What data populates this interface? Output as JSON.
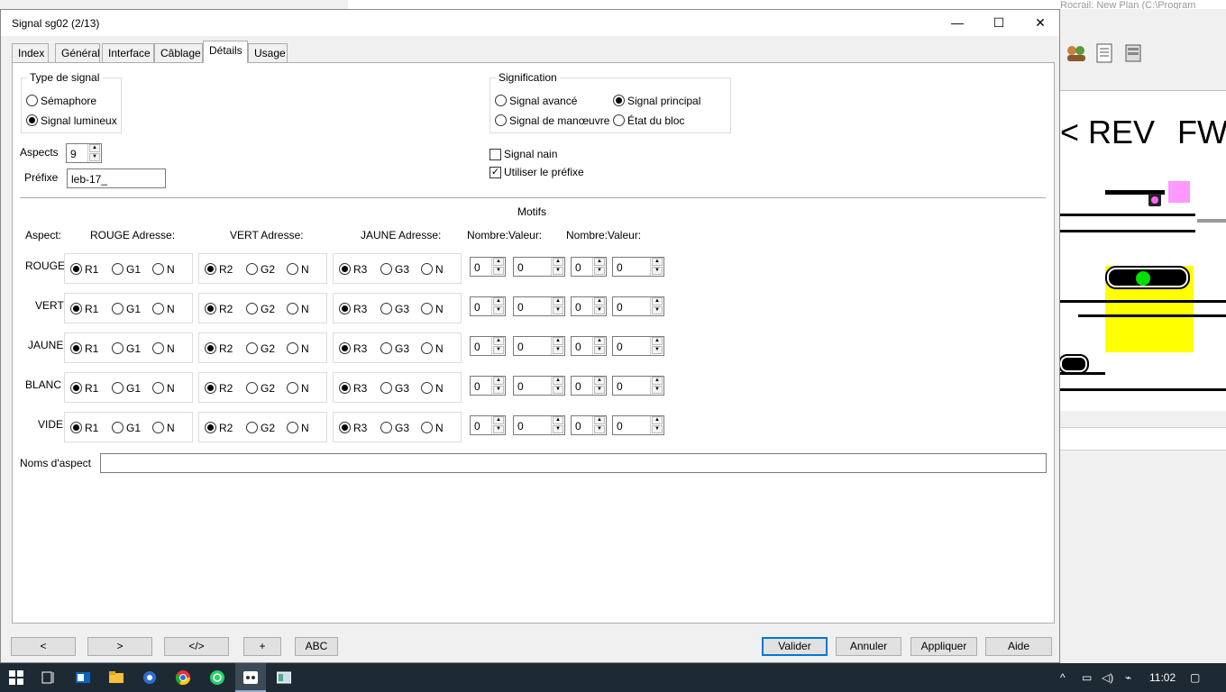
{
  "background_window": {
    "title": "Rocrail: New Plan (C:\\Program Files\\Rocrail\\bin)",
    "plan_labels": [
      "< REV",
      "FW"
    ]
  },
  "dialog": {
    "title": "Signal sg02 (2/13)",
    "controls": {
      "minimize": "—",
      "maximize": "☐",
      "close": "✕"
    },
    "tabs": [
      "Index",
      "Général",
      "Interface",
      "Câblage",
      "Détails",
      "Usage"
    ],
    "active_tab": "Détails",
    "signal_type": {
      "caption": "Type de signal",
      "options": [
        {
          "label": "Sémaphore",
          "selected": false
        },
        {
          "label": "Signal lumineux",
          "selected": true
        }
      ]
    },
    "signification": {
      "caption": "Signification",
      "options": [
        {
          "label": "Signal avancé",
          "selected": false
        },
        {
          "label": "Signal principal",
          "selected": true
        },
        {
          "label": "Signal de manœuvre",
          "selected": false
        },
        {
          "label": "État du bloc",
          "selected": false
        }
      ]
    },
    "aspects": {
      "label": "Aspects",
      "value": "9"
    },
    "prefix": {
      "label": "Préfixe",
      "value": "leb-17_"
    },
    "dwarf": {
      "label": "Signal nain",
      "checked": false
    },
    "use_prefix": {
      "label": "Utiliser le préfixe",
      "checked": true
    },
    "motifs": {
      "title": "Motifs",
      "headers": [
        "Aspect:",
        "ROUGE Adresse:",
        "VERT Adresse:",
        "JAUNE Adresse:",
        "Nombre:Valeur:",
        "Nombre:Valeur:"
      ],
      "rows": [
        {
          "aspect": "ROUGE",
          "r": "R1",
          "g": "G1",
          "n": "N",
          "r2": "R2",
          "g2": "G2",
          "n2": "N",
          "r3": "R3",
          "g3": "G3",
          "n3": "N",
          "nums": [
            "0",
            "0",
            "0",
            "0"
          ]
        },
        {
          "aspect": "VERT",
          "r": "R1",
          "g": "G1",
          "n": "N",
          "r2": "R2",
          "g2": "G2",
          "n2": "N",
          "r3": "R3",
          "g3": "G3",
          "n3": "N",
          "nums": [
            "0",
            "0",
            "0",
            "0"
          ]
        },
        {
          "aspect": "JAUNE",
          "r": "R1",
          "g": "G1",
          "n": "N",
          "r2": "R2",
          "g2": "G2",
          "n2": "N",
          "r3": "R3",
          "g3": "G3",
          "n3": "N",
          "nums": [
            "0",
            "0",
            "0",
            "0"
          ]
        },
        {
          "aspect": "BLANC",
          "r": "R1",
          "g": "G1",
          "n": "N",
          "r2": "R2",
          "g2": "G2",
          "n2": "N",
          "r3": "R3",
          "g3": "G3",
          "n3": "N",
          "nums": [
            "0",
            "0",
            "0",
            "0"
          ]
        },
        {
          "aspect": "VIDE",
          "r": "R1",
          "g": "G1",
          "n": "N",
          "r2": "R2",
          "g2": "G2",
          "n2": "N",
          "r3": "R3",
          "g3": "G3",
          "n3": "N",
          "nums": [
            "0",
            "0",
            "0",
            "0"
          ]
        }
      ]
    },
    "aspect_names": {
      "label": "Noms d'aspect",
      "value": ""
    },
    "nav_buttons": [
      "<",
      ">",
      "</>",
      "+",
      "ABC"
    ],
    "action_buttons": [
      "Valider",
      "Annuler",
      "Appliquer",
      "Aide"
    ]
  },
  "taskbar": {
    "time": "11:02",
    "icons": [
      "windows-start-icon",
      "task-view-icon",
      "outlook-icon",
      "file-explorer-icon",
      "app-icon",
      "chrome-icon",
      "whatsapp-icon",
      "rocrail-icon",
      "window-icon"
    ]
  },
  "colors": {
    "accent": "#0078d7",
    "taskbar": "#1e2a33",
    "yellow_block": "#ffff00",
    "signal_green": "#00e000",
    "pink": "#ff99ff"
  }
}
